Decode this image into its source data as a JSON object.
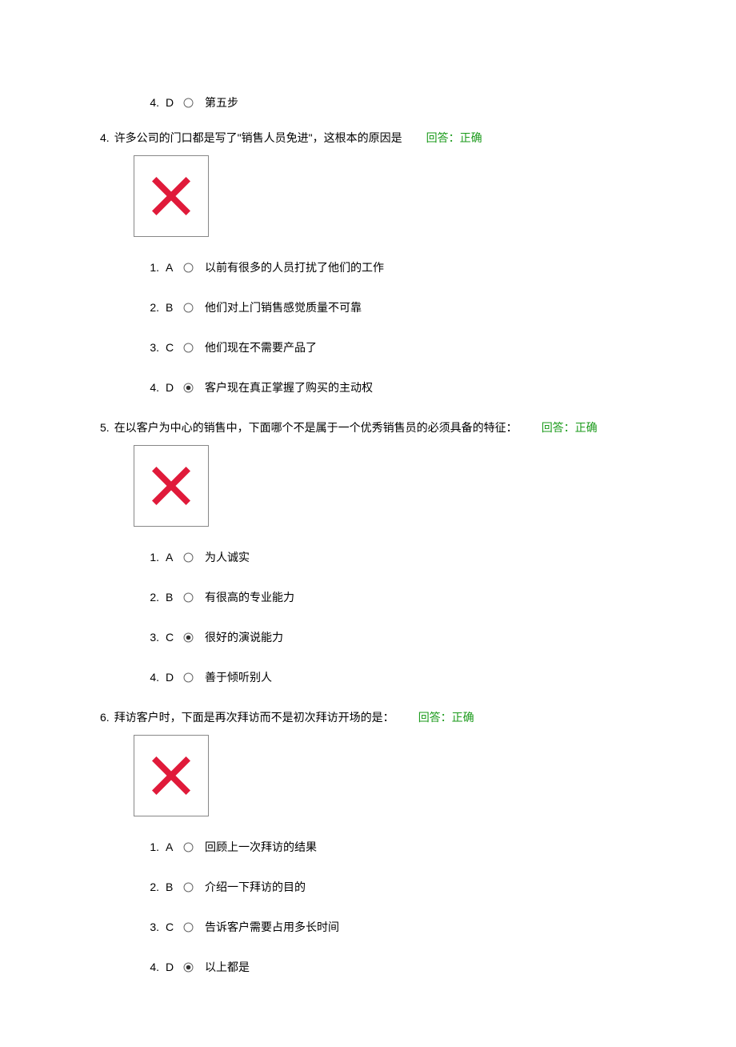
{
  "prevOption": {
    "num": "4.",
    "letter": "D",
    "selected": false,
    "text": "第五步"
  },
  "questions": [
    {
      "num": "4.",
      "text": "许多公司的门口都是写了\"销售人员免进\"，这根本的原因是",
      "status": "回答：正确",
      "options": [
        {
          "num": "1.",
          "letter": "A",
          "selected": false,
          "text": "以前有很多的人员打扰了他们的工作"
        },
        {
          "num": "2.",
          "letter": "B",
          "selected": false,
          "text": "他们对上门销售感觉质量不可靠"
        },
        {
          "num": "3.",
          "letter": "C",
          "selected": false,
          "text": "他们现在不需要产品了"
        },
        {
          "num": "4.",
          "letter": "D",
          "selected": true,
          "text": "客户现在真正掌握了购买的主动权"
        }
      ]
    },
    {
      "num": "5.",
      "text": "在以客户为中心的销售中，下面哪个不是属于一个优秀销售员的必须具备的特征：",
      "status": "回答：正确",
      "options": [
        {
          "num": "1.",
          "letter": "A",
          "selected": false,
          "text": "为人诚实"
        },
        {
          "num": "2.",
          "letter": "B",
          "selected": false,
          "text": "有很高的专业能力"
        },
        {
          "num": "3.",
          "letter": "C",
          "selected": true,
          "text": "很好的演说能力"
        },
        {
          "num": "4.",
          "letter": "D",
          "selected": false,
          "text": "善于倾听别人"
        }
      ]
    },
    {
      "num": "6.",
      "text": "拜访客户时，下面是再次拜访而不是初次拜访开场的是：",
      "status": "回答：正确",
      "options": [
        {
          "num": "1.",
          "letter": "A",
          "selected": false,
          "text": "回顾上一次拜访的结果"
        },
        {
          "num": "2.",
          "letter": "B",
          "selected": false,
          "text": "介绍一下拜访的目的"
        },
        {
          "num": "3.",
          "letter": "C",
          "selected": false,
          "text": "告诉客户需要占用多长时间"
        },
        {
          "num": "4.",
          "letter": "D",
          "selected": true,
          "text": "以上都是"
        }
      ]
    }
  ]
}
